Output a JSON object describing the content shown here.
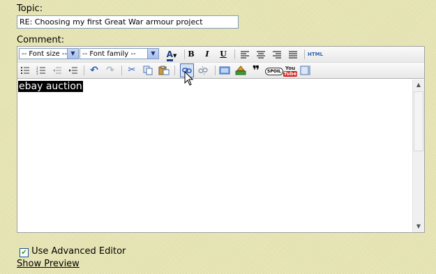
{
  "topic": {
    "label": "Topic:",
    "value": "RE: Choosing my first Great War armour project"
  },
  "comment": {
    "label": "Comment:"
  },
  "toolbar": {
    "font_size": "-- Font size --",
    "font_family": "-- Font family --",
    "bold": "B",
    "italic": "I",
    "underline": "U",
    "html": "HTML",
    "spoil": "SPOIL",
    "youtube_top": "You",
    "youtube_bottom": "Tube"
  },
  "editor": {
    "selected_text": "ebay auction"
  },
  "advanced": {
    "label": "Use Advanced Editor",
    "checked": true
  },
  "preview": {
    "label": "Show Preview"
  }
}
